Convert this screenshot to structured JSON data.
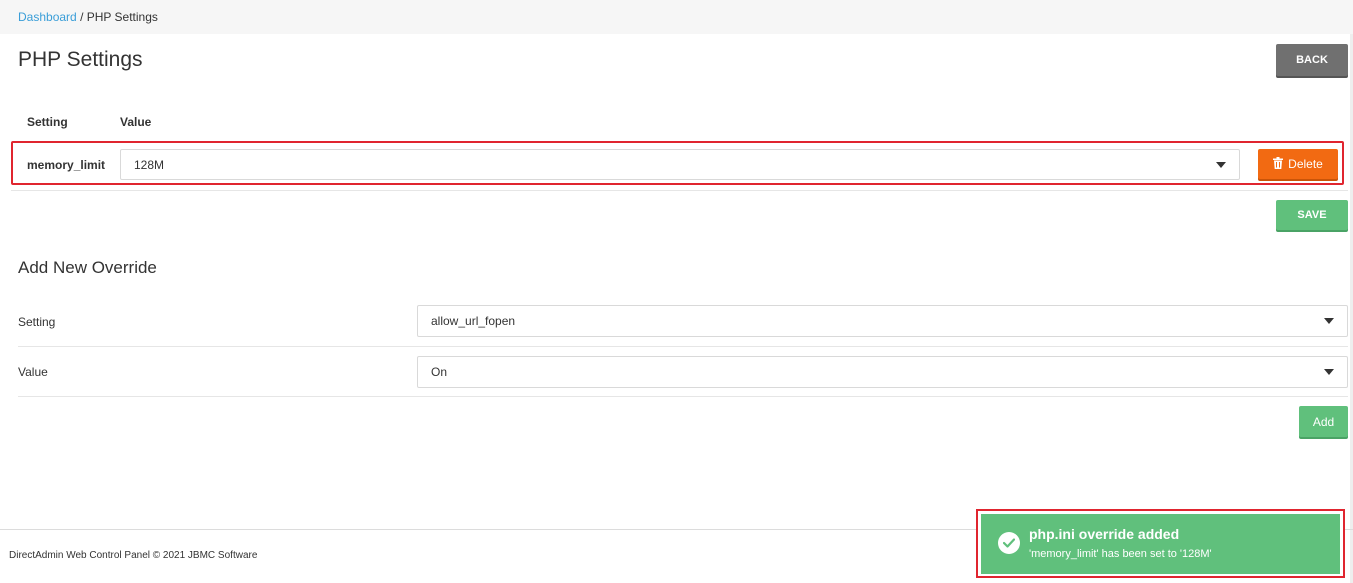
{
  "breadcrumb": {
    "home": "Dashboard",
    "separator": "/",
    "current": "PHP Settings"
  },
  "page": {
    "title": "PHP Settings",
    "back_label": "BACK"
  },
  "table": {
    "headers": [
      "Setting",
      "Value"
    ],
    "rows": [
      {
        "setting": "memory_limit",
        "value": "128M",
        "delete_label": "Delete"
      }
    ],
    "save_label": "SAVE"
  },
  "add_override": {
    "title": "Add New Override",
    "setting_label": "Setting",
    "setting_value": "allow_url_fopen",
    "value_label": "Value",
    "value_value": "On",
    "add_label": "Add"
  },
  "footer": {
    "text": "DirectAdmin Web Control Panel © 2021 JBMC Software"
  },
  "toast": {
    "title": "php.ini override added",
    "message": "'memory_limit' has been set to '128M'"
  },
  "colors": {
    "link": "#3a9ed8",
    "success": "#60c07c",
    "danger": "#f26a12",
    "neutral": "#707070",
    "highlight": "#e0252f"
  },
  "icons": {
    "delete": "trash-icon",
    "toast": "check-circle-icon",
    "select": "caret-down-icon"
  }
}
